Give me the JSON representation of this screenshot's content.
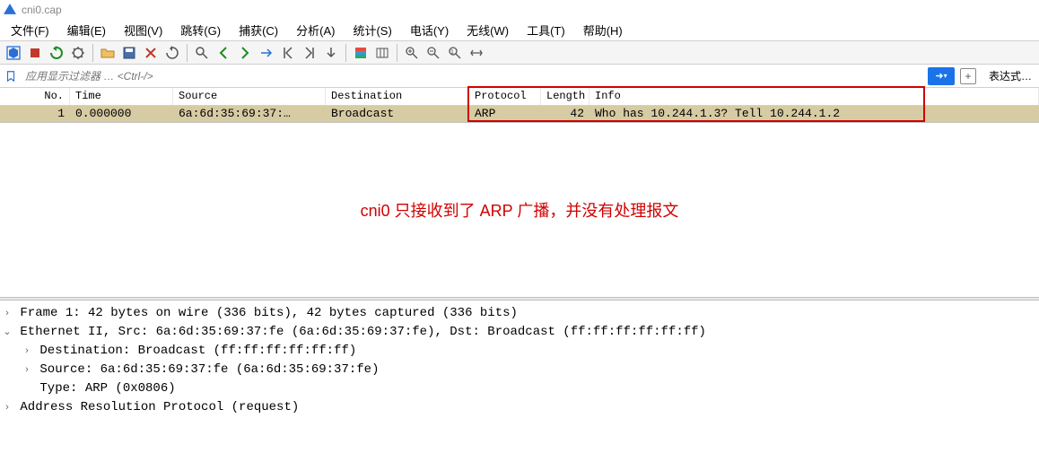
{
  "title": "cni0.cap",
  "menu": {
    "file": "文件(F)",
    "edit": "编辑(E)",
    "view": "视图(V)",
    "go": "跳转(G)",
    "capture": "捕获(C)",
    "analyze": "分析(A)",
    "statistics": "统计(S)",
    "telephony": "电话(Y)",
    "wireless": "无线(W)",
    "tools": "工具(T)",
    "help": "帮助(H)"
  },
  "filter": {
    "placeholder": "应用显示过滤器 … <Ctrl-/>",
    "expression_label": "表达式…",
    "dropdown_glyph": "▾",
    "arrow_glyph": "➜",
    "plus_glyph": "+"
  },
  "columns": {
    "no": "No.",
    "time": "Time",
    "src": "Source",
    "dst": "Destination",
    "proto": "Protocol",
    "len": "Length",
    "info": "Info"
  },
  "packets": [
    {
      "no": "1",
      "time": "0.000000",
      "src": "6a:6d:35:69:37:…",
      "dst": "Broadcast",
      "proto": "ARP",
      "len": "42",
      "info": "Who has 10.244.1.3? Tell 10.244.1.2"
    }
  ],
  "annotation_text": "cni0 只接收到了 ARP 广播，并没有处理报文",
  "details": {
    "frame": "Frame 1: 42 bytes on wire (336 bits), 42 bytes captured (336 bits)",
    "eth": "Ethernet II, Src: 6a:6d:35:69:37:fe (6a:6d:35:69:37:fe), Dst: Broadcast (ff:ff:ff:ff:ff:ff)",
    "eth_dst": "Destination: Broadcast (ff:ff:ff:ff:ff:ff)",
    "eth_src": "Source: 6a:6d:35:69:37:fe (6a:6d:35:69:37:fe)",
    "eth_type": "Type: ARP (0x0806)",
    "arp": "Address Resolution Protocol (request)"
  },
  "glyphs": {
    "collapsed": "›",
    "expanded": "⌄"
  }
}
